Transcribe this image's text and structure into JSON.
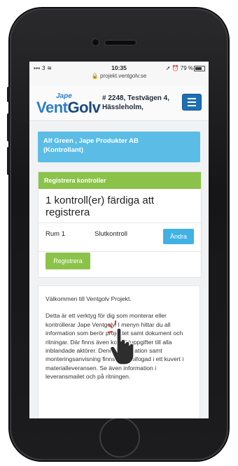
{
  "status_bar": {
    "signal": "3",
    "time": "10:35",
    "url": "projekt.ventgolv.se",
    "battery": "79 %"
  },
  "header": {
    "logo_top": "Jape",
    "logo_main_a": "Vent",
    "logo_main_b": "Golv",
    "project_line1": "# 2248, Testvägen 4,",
    "project_line2": "Hässleholm,"
  },
  "user_card": {
    "line1": "Alf Green , Jape Produkter AB",
    "line2": "(Kontrollant)"
  },
  "register_panel": {
    "heading": "Registrera kontroller",
    "title": "1 kontroll(er) färdiga att registrera",
    "rows": [
      {
        "room": "Rum 1",
        "type": "Slutkontroll",
        "action": "Ändra"
      }
    ],
    "submit_label": "Registrera"
  },
  "info": {
    "welcome": "Välkommen till Ventgolv Projekt.",
    "body": "Detta är ett verktyg för dig som monterar eller kontrollerar Jape Ventgolv. I menyn hittar du all information som berör projektet samt dokument och ritningar. Där finns även kontaktuppgifter till alla inblandade aktörer. Denna information samt monteringsanvisning finns även bifogad i ett kuvert i materialleveransen. Se även information i leveransmailet och på ritningen."
  },
  "colors": {
    "brand_blue": "#2e7ec4",
    "user_card": "#5bbde6",
    "green": "#8bc34a",
    "button_blue": "#3fb1e3"
  }
}
